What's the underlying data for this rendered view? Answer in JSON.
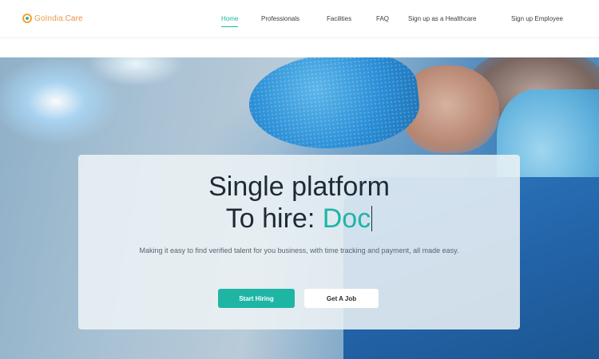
{
  "header": {
    "logo": {
      "part1": "GoIndia.",
      "part2": "Care"
    },
    "nav": [
      {
        "label": "Home",
        "active": true
      },
      {
        "label": "Professionals",
        "active": false
      },
      {
        "label": "Facilities",
        "active": false
      },
      {
        "label": "FAQ",
        "active": false
      },
      {
        "label": "Sign up as a Healthcare",
        "active": false
      },
      {
        "label": "Sign up Employee",
        "active": false
      }
    ]
  },
  "hero": {
    "headline_line1": "Single platform",
    "headline_line2_prefix": "To hire:",
    "headline_line2_typed": "Doc",
    "subtext": "Making it easy to find verified talent for you business, with time tracking and payment, all made easy.",
    "primary_button": "Start Hiring",
    "secondary_button": "Get A Job"
  },
  "colors": {
    "accent": "#1fb5a5",
    "logo_orange": "#e4a04a",
    "text_dark": "#1f2a33"
  }
}
